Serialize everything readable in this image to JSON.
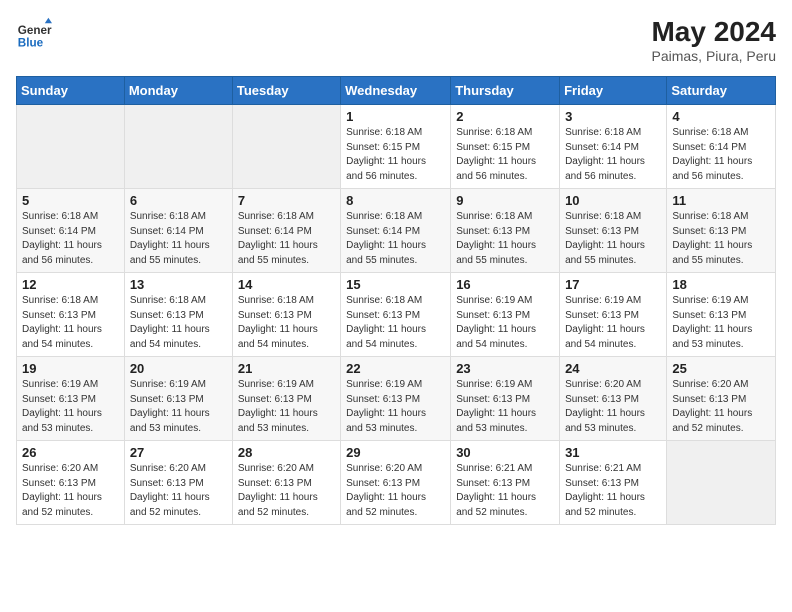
{
  "header": {
    "logo_line1": "General",
    "logo_line2": "Blue",
    "month_year": "May 2024",
    "location": "Paimas, Piura, Peru"
  },
  "weekdays": [
    "Sunday",
    "Monday",
    "Tuesday",
    "Wednesday",
    "Thursday",
    "Friday",
    "Saturday"
  ],
  "weeks": [
    [
      {
        "day": "",
        "info": ""
      },
      {
        "day": "",
        "info": ""
      },
      {
        "day": "",
        "info": ""
      },
      {
        "day": "1",
        "info": "Sunrise: 6:18 AM\nSunset: 6:15 PM\nDaylight: 11 hours and 56 minutes."
      },
      {
        "day": "2",
        "info": "Sunrise: 6:18 AM\nSunset: 6:15 PM\nDaylight: 11 hours and 56 minutes."
      },
      {
        "day": "3",
        "info": "Sunrise: 6:18 AM\nSunset: 6:14 PM\nDaylight: 11 hours and 56 minutes."
      },
      {
        "day": "4",
        "info": "Sunrise: 6:18 AM\nSunset: 6:14 PM\nDaylight: 11 hours and 56 minutes."
      }
    ],
    [
      {
        "day": "5",
        "info": "Sunrise: 6:18 AM\nSunset: 6:14 PM\nDaylight: 11 hours and 56 minutes."
      },
      {
        "day": "6",
        "info": "Sunrise: 6:18 AM\nSunset: 6:14 PM\nDaylight: 11 hours and 55 minutes."
      },
      {
        "day": "7",
        "info": "Sunrise: 6:18 AM\nSunset: 6:14 PM\nDaylight: 11 hours and 55 minutes."
      },
      {
        "day": "8",
        "info": "Sunrise: 6:18 AM\nSunset: 6:14 PM\nDaylight: 11 hours and 55 minutes."
      },
      {
        "day": "9",
        "info": "Sunrise: 6:18 AM\nSunset: 6:13 PM\nDaylight: 11 hours and 55 minutes."
      },
      {
        "day": "10",
        "info": "Sunrise: 6:18 AM\nSunset: 6:13 PM\nDaylight: 11 hours and 55 minutes."
      },
      {
        "day": "11",
        "info": "Sunrise: 6:18 AM\nSunset: 6:13 PM\nDaylight: 11 hours and 55 minutes."
      }
    ],
    [
      {
        "day": "12",
        "info": "Sunrise: 6:18 AM\nSunset: 6:13 PM\nDaylight: 11 hours and 54 minutes."
      },
      {
        "day": "13",
        "info": "Sunrise: 6:18 AM\nSunset: 6:13 PM\nDaylight: 11 hours and 54 minutes."
      },
      {
        "day": "14",
        "info": "Sunrise: 6:18 AM\nSunset: 6:13 PM\nDaylight: 11 hours and 54 minutes."
      },
      {
        "day": "15",
        "info": "Sunrise: 6:18 AM\nSunset: 6:13 PM\nDaylight: 11 hours and 54 minutes."
      },
      {
        "day": "16",
        "info": "Sunrise: 6:19 AM\nSunset: 6:13 PM\nDaylight: 11 hours and 54 minutes."
      },
      {
        "day": "17",
        "info": "Sunrise: 6:19 AM\nSunset: 6:13 PM\nDaylight: 11 hours and 54 minutes."
      },
      {
        "day": "18",
        "info": "Sunrise: 6:19 AM\nSunset: 6:13 PM\nDaylight: 11 hours and 53 minutes."
      }
    ],
    [
      {
        "day": "19",
        "info": "Sunrise: 6:19 AM\nSunset: 6:13 PM\nDaylight: 11 hours and 53 minutes."
      },
      {
        "day": "20",
        "info": "Sunrise: 6:19 AM\nSunset: 6:13 PM\nDaylight: 11 hours and 53 minutes."
      },
      {
        "day": "21",
        "info": "Sunrise: 6:19 AM\nSunset: 6:13 PM\nDaylight: 11 hours and 53 minutes."
      },
      {
        "day": "22",
        "info": "Sunrise: 6:19 AM\nSunset: 6:13 PM\nDaylight: 11 hours and 53 minutes."
      },
      {
        "day": "23",
        "info": "Sunrise: 6:19 AM\nSunset: 6:13 PM\nDaylight: 11 hours and 53 minutes."
      },
      {
        "day": "24",
        "info": "Sunrise: 6:20 AM\nSunset: 6:13 PM\nDaylight: 11 hours and 53 minutes."
      },
      {
        "day": "25",
        "info": "Sunrise: 6:20 AM\nSunset: 6:13 PM\nDaylight: 11 hours and 52 minutes."
      }
    ],
    [
      {
        "day": "26",
        "info": "Sunrise: 6:20 AM\nSunset: 6:13 PM\nDaylight: 11 hours and 52 minutes."
      },
      {
        "day": "27",
        "info": "Sunrise: 6:20 AM\nSunset: 6:13 PM\nDaylight: 11 hours and 52 minutes."
      },
      {
        "day": "28",
        "info": "Sunrise: 6:20 AM\nSunset: 6:13 PM\nDaylight: 11 hours and 52 minutes."
      },
      {
        "day": "29",
        "info": "Sunrise: 6:20 AM\nSunset: 6:13 PM\nDaylight: 11 hours and 52 minutes."
      },
      {
        "day": "30",
        "info": "Sunrise: 6:21 AM\nSunset: 6:13 PM\nDaylight: 11 hours and 52 minutes."
      },
      {
        "day": "31",
        "info": "Sunrise: 6:21 AM\nSunset: 6:13 PM\nDaylight: 11 hours and 52 minutes."
      },
      {
        "day": "",
        "info": ""
      }
    ]
  ]
}
